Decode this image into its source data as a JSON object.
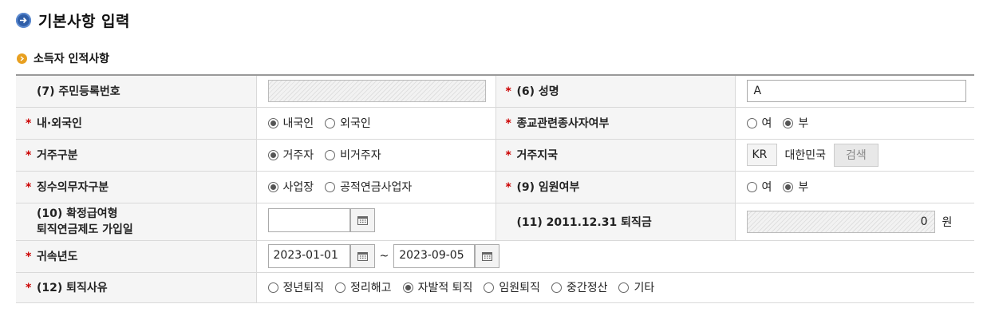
{
  "page": {
    "title": "기본사항 입력"
  },
  "section": {
    "title": "소득자 인적사항"
  },
  "rows": {
    "resident_no": {
      "label": "(7) 주민등록번호",
      "value": ""
    },
    "name": {
      "label": "(6) 성명",
      "value": "A"
    },
    "nationality": {
      "label": "내·외국인",
      "options": [
        "내국인",
        "외국인"
      ],
      "selected": "내국인"
    },
    "religion": {
      "label": "종교관련종사자여부",
      "options": [
        "여",
        "부"
      ],
      "selected": "부"
    },
    "residence": {
      "label": "거주구분",
      "options": [
        "거주자",
        "비거주자"
      ],
      "selected": "거주자"
    },
    "residence_region": {
      "label": "거주지국",
      "code": "KR",
      "country": "대한민국",
      "search_label": "검색"
    },
    "withholding": {
      "label": "징수의무자구분",
      "options": [
        "사업장",
        "공적연금사업자"
      ],
      "selected": "사업장"
    },
    "executive": {
      "label": "(9) 임원여부",
      "options": [
        "여",
        "부"
      ],
      "selected": "부"
    },
    "db_pension": {
      "label_line1": "(10) 확정급여형",
      "label_line2": "퇴직연금제도 가입일",
      "value": ""
    },
    "severance_2011": {
      "label": "(11) 2011.12.31 퇴직금",
      "value": "0",
      "unit": "원"
    },
    "period": {
      "label": "귀속년도",
      "from": "2023-01-01",
      "tilde": "~",
      "to": "2023-09-05"
    },
    "reason": {
      "label": "(12) 퇴직사유",
      "options": [
        "정년퇴직",
        "정리해고",
        "자발적 퇴직",
        "임원퇴직",
        "중간정산",
        "기타"
      ],
      "selected": "자발적 퇴직"
    }
  },
  "colors": {
    "required_star": "#cc0000",
    "header_icon": "#2f5ea8",
    "section_icon": "#e8a020"
  }
}
